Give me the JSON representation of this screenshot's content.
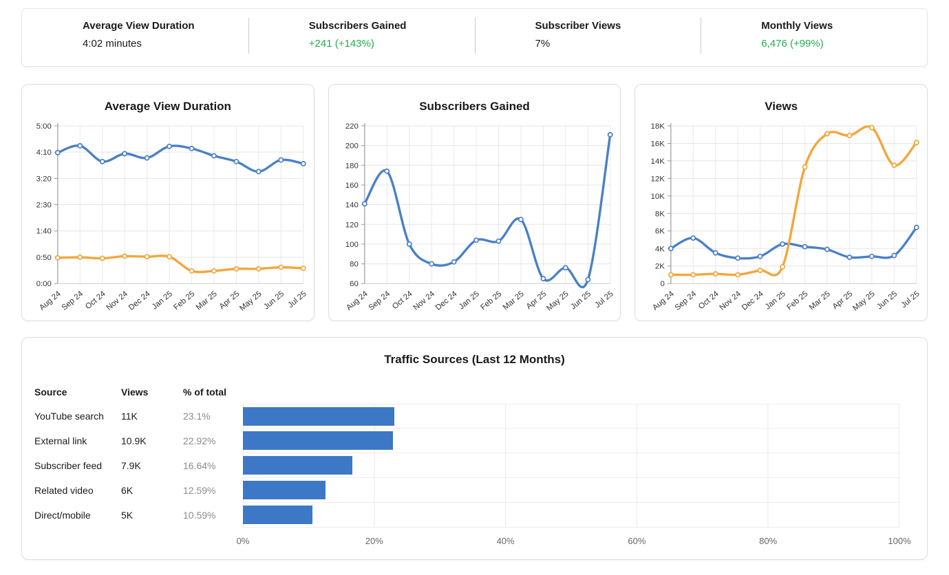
{
  "stats": {
    "items": [
      {
        "label": "Average View Duration",
        "value": "4:02 minutes",
        "value_color": "#1a1a1a"
      },
      {
        "label": "Subscribers Gained",
        "value": "+241 (+143%)",
        "value_color": "#23ad52"
      },
      {
        "label": "Subscriber Views",
        "value": "7%",
        "value_color": "#1a1a1a"
      },
      {
        "label": "Monthly Views",
        "value": "6,476 (+99%)",
        "value_color": "#23ad52"
      }
    ]
  },
  "chart_data": [
    {
      "type": "line",
      "title": "Average View Duration",
      "x_labels": [
        "Aug 24",
        "Sep 24",
        "Oct 24",
        "Nov 24",
        "Dec 24",
        "Jan 25",
        "Feb 25",
        "Mar 25",
        "Apr 25",
        "May 25",
        "Jun 25",
        "Jul 25"
      ],
      "y_unit": "duration_seconds",
      "y_min": 0,
      "y_max": 300,
      "grid": true,
      "y_ticks": [
        {
          "v": 300,
          "label": "5:00"
        },
        {
          "v": 250,
          "label": "4:10"
        },
        {
          "v": 200,
          "label": "3:20"
        },
        {
          "v": 150,
          "label": "2:30"
        },
        {
          "v": 100,
          "label": "1:40"
        },
        {
          "v": 50,
          "label": "0:50"
        },
        {
          "v": 0,
          "label": "0:00"
        }
      ],
      "series": [
        {
          "name": "current-period",
          "color": "#4a80c6",
          "values": [
            249,
            262,
            232,
            247,
            239,
            261,
            257,
            243,
            232,
            213,
            235,
            228
          ]
        },
        {
          "name": "comparison-period",
          "color": "#f3a63b",
          "values": [
            49,
            50,
            48,
            52,
            51,
            51,
            24,
            24,
            28,
            28,
            31,
            29
          ]
        }
      ]
    },
    {
      "type": "line",
      "title": "Subscribers Gained",
      "x_labels": [
        "Aug 24",
        "Sep 24",
        "Oct 24",
        "Nov 24",
        "Dec 24",
        "Jan 25",
        "Feb 25",
        "Mar 25",
        "Apr 25",
        "May 25",
        "Jun 25",
        "Jul 25"
      ],
      "y_min": 60,
      "y_max": 220,
      "grid": true,
      "y_ticks": [
        {
          "v": 220,
          "label": "220"
        },
        {
          "v": 200,
          "label": "200"
        },
        {
          "v": 180,
          "label": "180"
        },
        {
          "v": 160,
          "label": "160"
        },
        {
          "v": 140,
          "label": "140"
        },
        {
          "v": 120,
          "label": "120"
        },
        {
          "v": 100,
          "label": "100"
        },
        {
          "v": 80,
          "label": "80"
        },
        {
          "v": 60,
          "label": "60"
        }
      ],
      "series": [
        {
          "name": "subscribers-gained",
          "color": "#4a80c6",
          "values": [
            141,
            174,
            100,
            80,
            82,
            104,
            103,
            125,
            65,
            76,
            64,
            211
          ]
        }
      ]
    },
    {
      "type": "line",
      "title": "Views",
      "x_labels": [
        "Aug 24",
        "Sep 24",
        "Oct 24",
        "Nov 24",
        "Dec 24",
        "Jan 25",
        "Feb 25",
        "Mar 25",
        "Apr 25",
        "May 25",
        "Jun 25",
        "Jul 25"
      ],
      "y_min": 0,
      "y_max": 18000,
      "grid": true,
      "y_ticks": [
        {
          "v": 18000,
          "label": "18K"
        },
        {
          "v": 16000,
          "label": "16K"
        },
        {
          "v": 14000,
          "label": "14K"
        },
        {
          "v": 12000,
          "label": "12K"
        },
        {
          "v": 10000,
          "label": "10K"
        },
        {
          "v": 8000,
          "label": "8K"
        },
        {
          "v": 6000,
          "label": "6K"
        },
        {
          "v": 4000,
          "label": "4K"
        },
        {
          "v": 2000,
          "label": "2K"
        },
        {
          "v": 0,
          "label": "0"
        }
      ],
      "series": [
        {
          "name": "views-current",
          "color": "#4a80c6",
          "values": [
            4000,
            5200,
            3500,
            2900,
            3100,
            4500,
            4200,
            3900,
            3000,
            3100,
            3200,
            6400
          ]
        },
        {
          "name": "views-comparison",
          "color": "#f3a63b",
          "values": [
            1000,
            1000,
            1100,
            1000,
            1500,
            1900,
            13300,
            17100,
            16900,
            17800,
            13500,
            16100
          ]
        }
      ]
    },
    {
      "type": "bar",
      "orientation": "horizontal",
      "title": "Traffic Sources (Last 12 Months)",
      "table_columns": [
        "Source",
        "Views",
        "% of total"
      ],
      "categories": [
        "YouTube search",
        "External link",
        "Subscriber feed",
        "Related video",
        "Direct/mobile"
      ],
      "views_labels": [
        "11K",
        "10.9K",
        "7.9K",
        "6K",
        "5K"
      ],
      "values": [
        23.1,
        22.92,
        16.64,
        12.59,
        10.59
      ],
      "value_labels": [
        "23.1%",
        "22.92%",
        "16.64%",
        "12.59%",
        "10.59%"
      ],
      "xlim": [
        0,
        100
      ],
      "x_tick_labels": [
        "0%",
        "20%",
        "40%",
        "60%",
        "80%",
        "100%"
      ],
      "bar_color": "#3d78c6",
      "grid": true
    }
  ],
  "colors": {
    "line_blue": "#4a80c6",
    "line_orange": "#f3a63b",
    "bar_blue": "#3d78c6",
    "positive_green": "#23ad52",
    "muted_text": "#8b8b8b"
  }
}
